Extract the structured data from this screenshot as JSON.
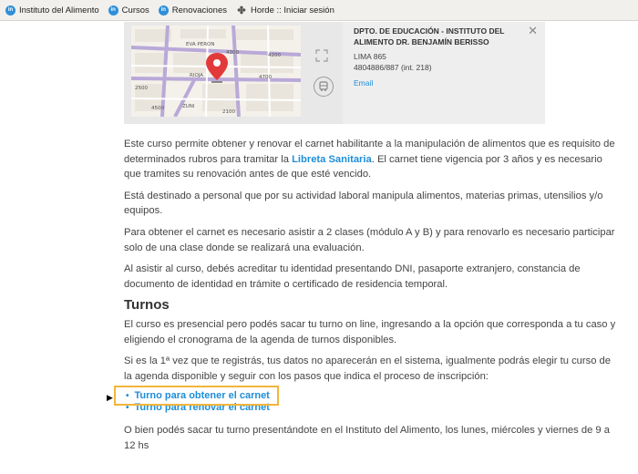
{
  "bookmarks": [
    {
      "icon": "in",
      "label": "Instituto del Alimento"
    },
    {
      "icon": "in",
      "label": "Cursos"
    },
    {
      "icon": "in",
      "label": "Renovaciones"
    },
    {
      "icon": "horde",
      "label": "Horde :: Iniciar sesión"
    }
  ],
  "map": {
    "streets": [
      "EVA PERON",
      "RIOJA",
      "4300",
      "4400",
      "4200",
      "4700",
      "4500",
      "2500",
      "2100",
      "ZUNI"
    ],
    "info": {
      "title": "DPTO. DE EDUCACIÓN - INSTITUTO DEL ALIMENTO DR. BENJAMÍN BERISSO",
      "address": "LIMA 865",
      "phone": "4804886/887 (int. 218)",
      "email": "Email",
      "close": "✕"
    }
  },
  "content": {
    "p1_a": "Este curso permite obtener y renovar el carnet habilitante a la manipulación de alimentos que es requisito de determinados rubros para tramitar la ",
    "p1_link": "Libreta Sanitaria",
    "p1_b": ". El carnet tiene vigencia por 3 años y es necesario que tramites su renovación antes de que esté vencido.",
    "p2": "Está destinado a personal que por su actividad laboral manipula alimentos, materias primas, utensilios y/o equipos.",
    "p3": "Para obtener el carnet es necesario asistir a 2 clases (módulo A y B) y para renovarlo es necesario participar solo de una clase donde se realizará una evaluación.",
    "p4": "Al asistir al curso, debés acreditar tu identidad presentando DNI, pasaporte extranjero, constancia de documento de identidad en trámite o certificado de residencia temporal.",
    "heading": "Turnos",
    "p5": "El curso es presencial pero podés sacar tu turno on line, ingresando a la opción que corresponda a tu caso y eligiendo el cronograma de la agenda de turnos disponibles.",
    "p6": "Si es la 1ª vez que te registrás, tus datos no aparecerán en el sistema, igualmente podrás elegir tu curso de la agenda disponible y seguir con los pasos que indica el proceso de inscripción:",
    "link1": "Turno para obtener el carnet",
    "link2": "Turno para renovar el carnet",
    "p7": "O bien podés sacar tu turno presentándote en el Instituto del Alimento, los lunes, miércoles y viernes de 9 a 12 hs"
  },
  "colors": {
    "link": "#1d8ed8",
    "highlight": "#f3b53b",
    "pin": "#e23a3a"
  }
}
